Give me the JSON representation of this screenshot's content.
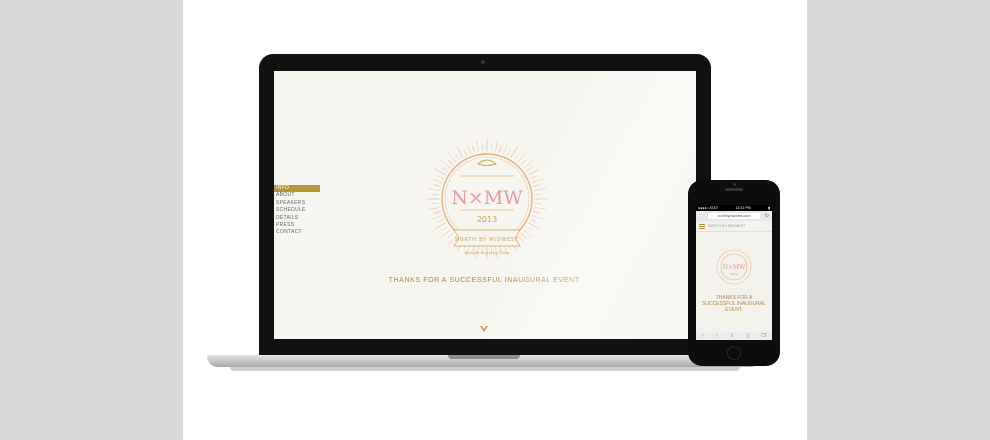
{
  "laptop": {
    "nav_items": [
      "INFO",
      "ABOUT",
      "SPEAKERS",
      "SCHEDULE",
      "DETAILS",
      "PRESS",
      "CONTACT"
    ],
    "active_nav": "INFO",
    "emblem": {
      "logo_text": "N×MW",
      "year": "2013",
      "ribbon_text": "NORTH BY MIDWEST",
      "tagline": "Brought to you by Claire"
    },
    "headline": "THANKS FOR A SUCCESSFUL INAUGURAL EVENT."
  },
  "phone": {
    "carrier": "●●●●○ AT&T",
    "time": "12:21 PM",
    "battery": "▮",
    "url": "northbymidwest.com",
    "site_name": "NORTH BY MIDWEST",
    "headline": "THANKS FOR A SUCCESSFUL INAUGURAL EVENT.",
    "toolbar_icons": [
      "back-icon",
      "forward-icon",
      "share-icon",
      "bookmarks-icon",
      "tabs-icon"
    ]
  },
  "colors": {
    "accent_gold": "#b8962e",
    "emblem_pink": "#e79aa6",
    "emblem_orange": "#e8a24a",
    "screen_bg": "#f6f5f0"
  }
}
